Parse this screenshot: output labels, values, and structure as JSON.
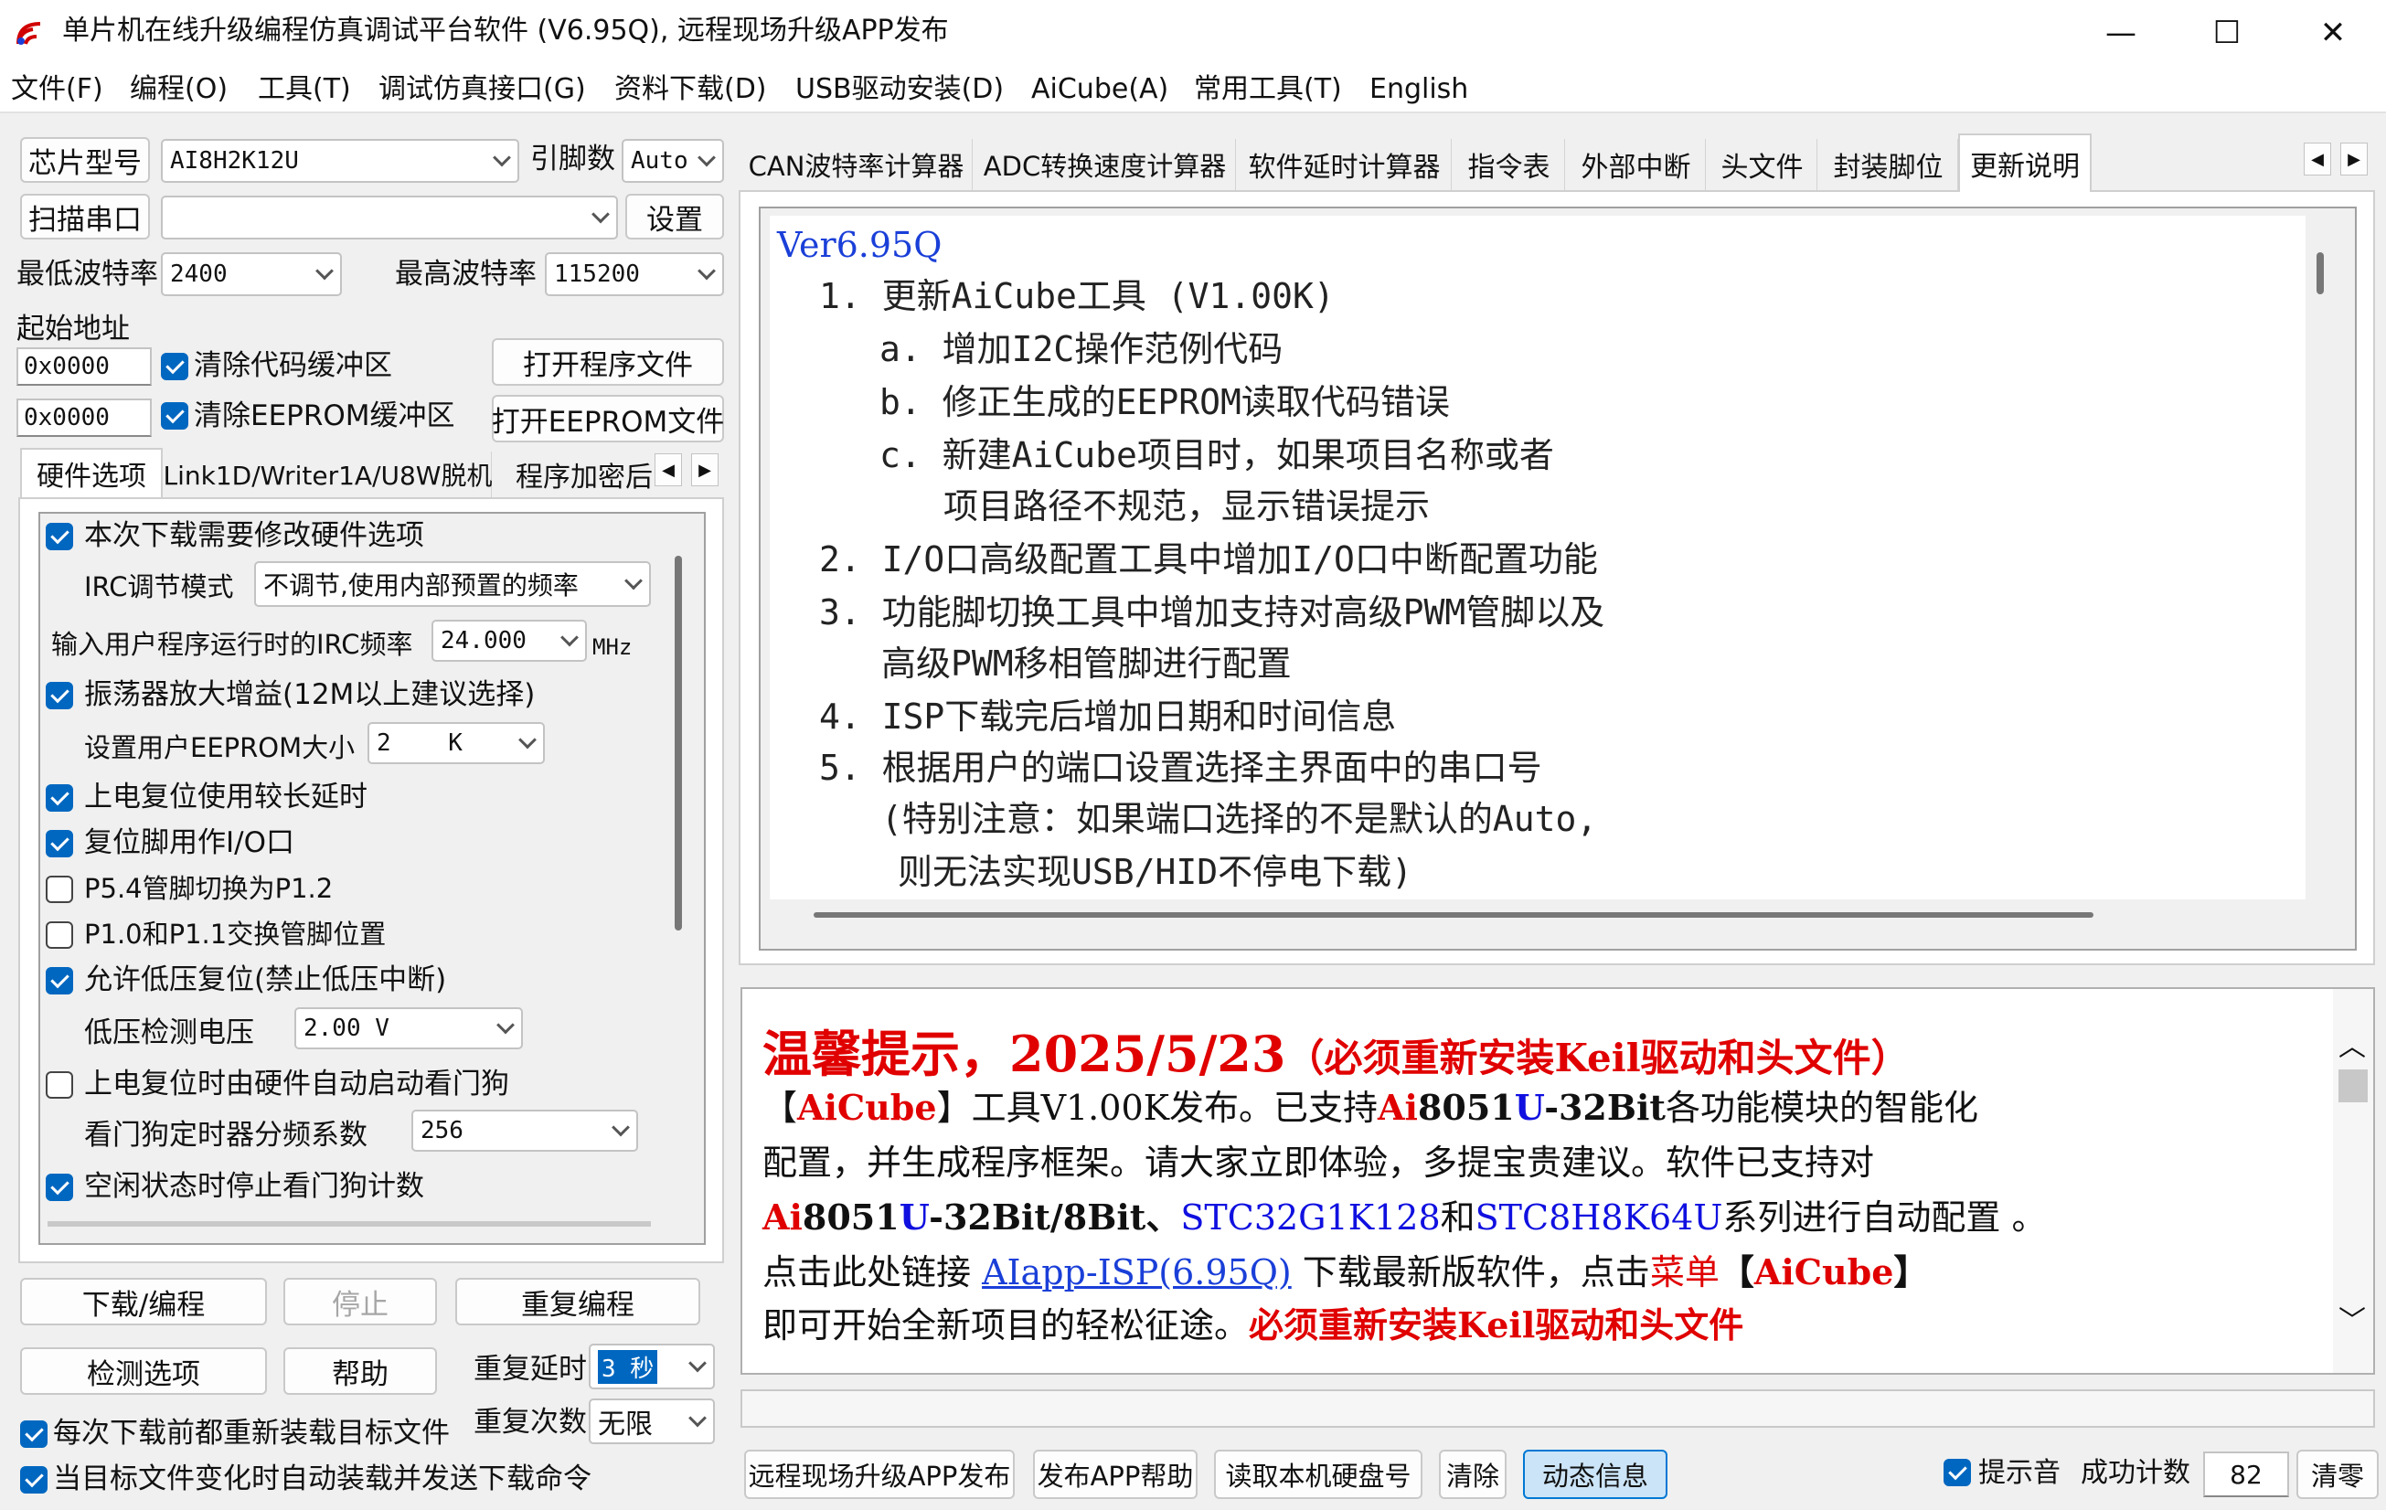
{
  "window": {
    "title": "单片机在线升级编程仿真调试平台软件 (V6.95Q), 远程现场升级APP发布",
    "minimize": "—",
    "maximize": "☐",
    "close": "✕"
  },
  "menu": [
    "文件(F)",
    "编程(O)",
    "工具(T)",
    "调试仿真接口(G)",
    "资料下载(D)",
    "USB驱动安装(D)",
    "AiCube(A)",
    "常用工具(T)",
    "English"
  ],
  "left": {
    "chip_btn": "芯片型号",
    "chip_value": "AI8H2K12U",
    "pin_label": "引脚数",
    "pin_value": "Auto",
    "scan_btn": "扫描串口",
    "port_value": "",
    "settings_btn": "设置",
    "min_baud_label": "最低波特率",
    "min_baud_value": "2400",
    "max_baud_label": "最高波特率",
    "max_baud_value": "115200",
    "start_addr_label": "起始地址",
    "addr1": "0x0000",
    "addr2": "0x0000",
    "clear_code_label": "清除代码缓冲区",
    "clear_eeprom_label": "清除EEPROM缓冲区",
    "open_prog_btn": "打开程序文件",
    "open_eeprom_btn": "打开EEPROM文件",
    "tabs": [
      "硬件选项",
      "Link1D/Writer1A/U8W脱机",
      "程序加密后"
    ],
    "hw": {
      "opt_modify": "本次下载需要修改硬件选项",
      "irc_mode_label": "IRC调节模式",
      "irc_mode_value": "不调节,使用内部预置的频率",
      "irc_freq_label": "输入用户程序运行时的IRC频率",
      "irc_freq_value": "24.000",
      "irc_unit": "MHz",
      "osc_gain": "振荡器放大增益(12M以上建议选择)",
      "eeprom_size_label": "设置用户EEPROM大小",
      "eeprom_size_value": "2    K",
      "por_delay": "上电复位使用较长延时",
      "reset_io": "复位脚用作I/O口",
      "p54": "P5.4管脚切换为P1.2",
      "p10": "P1.0和P1.1交换管脚位置",
      "lvr": "允许低压复位(禁止低压中断)",
      "lvd_label": "低压检测电压",
      "lvd_value": "2.00 V",
      "wdt_auto": "上电复位时由硬件自动启动看门狗",
      "wdt_div_label": "看门狗定时器分频系数",
      "wdt_div_value": "256",
      "wdt_idle": "空闲状态时停止看门狗计数"
    },
    "download_btn": "下载/编程",
    "stop_btn": "停止",
    "reprogram_btn": "重复编程",
    "check_btn": "检测选项",
    "help_btn": "帮助",
    "repeat_delay_label": "重复延时",
    "repeat_delay_value": "3 秒",
    "repeat_count_label": "重复次数",
    "repeat_count_value": "无限",
    "reload_label": "每次下载前都重新装载目标文件",
    "auto_send_label": "当目标文件变化时自动装载并发送下载命令"
  },
  "right": {
    "tabs": [
      "CAN波特率计算器",
      "ADC转换速度计算器",
      "软件延时计算器",
      "指令表",
      "外部中断",
      "头文件",
      "封装脚位",
      "更新说明"
    ],
    "notes": [
      "Ver6.95Q",
      "1. 更新AiCube工具 (V1.00K)",
      "a. 增加I2C操作范例代码",
      "b. 修正生成的EEPROM读取代码错误",
      "c. 新建AiCube项目时，如果项目名称或者",
      "项目路径不规范，显示错误提示",
      "2. I/O口高级配置工具中增加I/O口中断配置功能",
      "3. 功能脚切换工具中增加支持对高级PWM管脚以及",
      "高级PWM移相管脚进行配置",
      "4. ISP下载完后增加日期和时间信息",
      "5. 根据用户的端口设置选择主界面中的串口号",
      "(特别注意：如果端口选择的不是默认的Auto,",
      "则无法实现USB/HID不停电下载)"
    ],
    "tip": {
      "heading": "温馨提示，2025/5/23",
      "heading_note": "（必须重新安装Keil驱动和头文件）",
      "l1a": "【",
      "l1b": "AiCube",
      "l1c": "】工具V1.00K发布。已支持",
      "l1d": "Ai",
      "l1e": "8051",
      "l1f": "U",
      "l1g": "-32Bit",
      "l1h": "各功能模块的智能化",
      "l2": "配置，并生成程序框架。请大家立即体验，多提宝贵建议。软件已支持对",
      "l3a": "Ai",
      "l3b": "8051",
      "l3c": "U",
      "l3d": "-32Bit/8Bit、",
      "l3e": "STC32G1K128",
      "l3f": "和",
      "l3g": "STC8H8K64U",
      "l3h": "系列进行自动配置 。",
      "l4a": "点击此处链接 ",
      "l4b": "AIapp-ISP(6.95Q)",
      "l4c": " 下载最新版软件，点击",
      "l4d": "菜单",
      "l4e": "【",
      "l4f": "AiCube",
      "l4g": "】",
      "l5a": "即可开始全新项目的轻松征途。",
      "l5b": "必须重新安装Keil驱动和头文件"
    },
    "bottom": {
      "remote_btn": "远程现场升级APP发布",
      "publish_help_btn": "发布APP帮助",
      "read_disk_btn": "读取本机硬盘号",
      "clear_btn": "清除",
      "dynamic_btn": "动态信息",
      "sound_label": "提示音",
      "success_label": "成功计数",
      "success_value": "82",
      "zero_btn": "清零"
    }
  },
  "colors": {
    "accent": "#0067c0",
    "red": "#e00000",
    "blue": "#1010e0"
  }
}
